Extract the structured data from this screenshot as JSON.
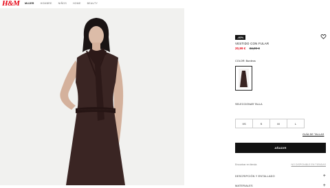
{
  "brand": {
    "logo_text": "H&M",
    "accent_color": "#e50010"
  },
  "nav": {
    "items": [
      "MUJER",
      "HOMBRE",
      "NIÑOS",
      "HOME",
      "BEAUTY"
    ],
    "active": "MUJER"
  },
  "product": {
    "discount_badge": "-40%",
    "name": "VESTIDO CON FULAR",
    "price_current": "20,99 €",
    "price_original": "34,99 €",
    "color_label": "COLOR: Burdeos",
    "wishlist_icon": "heart-outline-icon",
    "colors": {
      "dress": "#3a2523",
      "background": "#f1f1ef",
      "skin": "#d9b8a3"
    }
  },
  "sizes": {
    "label": "SELECCIONAR TALLA",
    "options": [
      "XS",
      "S",
      "M",
      "L"
    ],
    "guide_link": "GUÍA DE TALLAS"
  },
  "actions": {
    "add_to_bag": "AÑADIR",
    "find_in_store": "Encontrar en tienda",
    "store_availability": "NO DISPONIBLE EN TIENDAS"
  },
  "accordions": [
    {
      "label": "DESCRIPCIÓN Y ENTALLADO",
      "icon": "plus-icon"
    },
    {
      "label": "MATERIALES",
      "icon": "plus-icon"
    }
  ]
}
